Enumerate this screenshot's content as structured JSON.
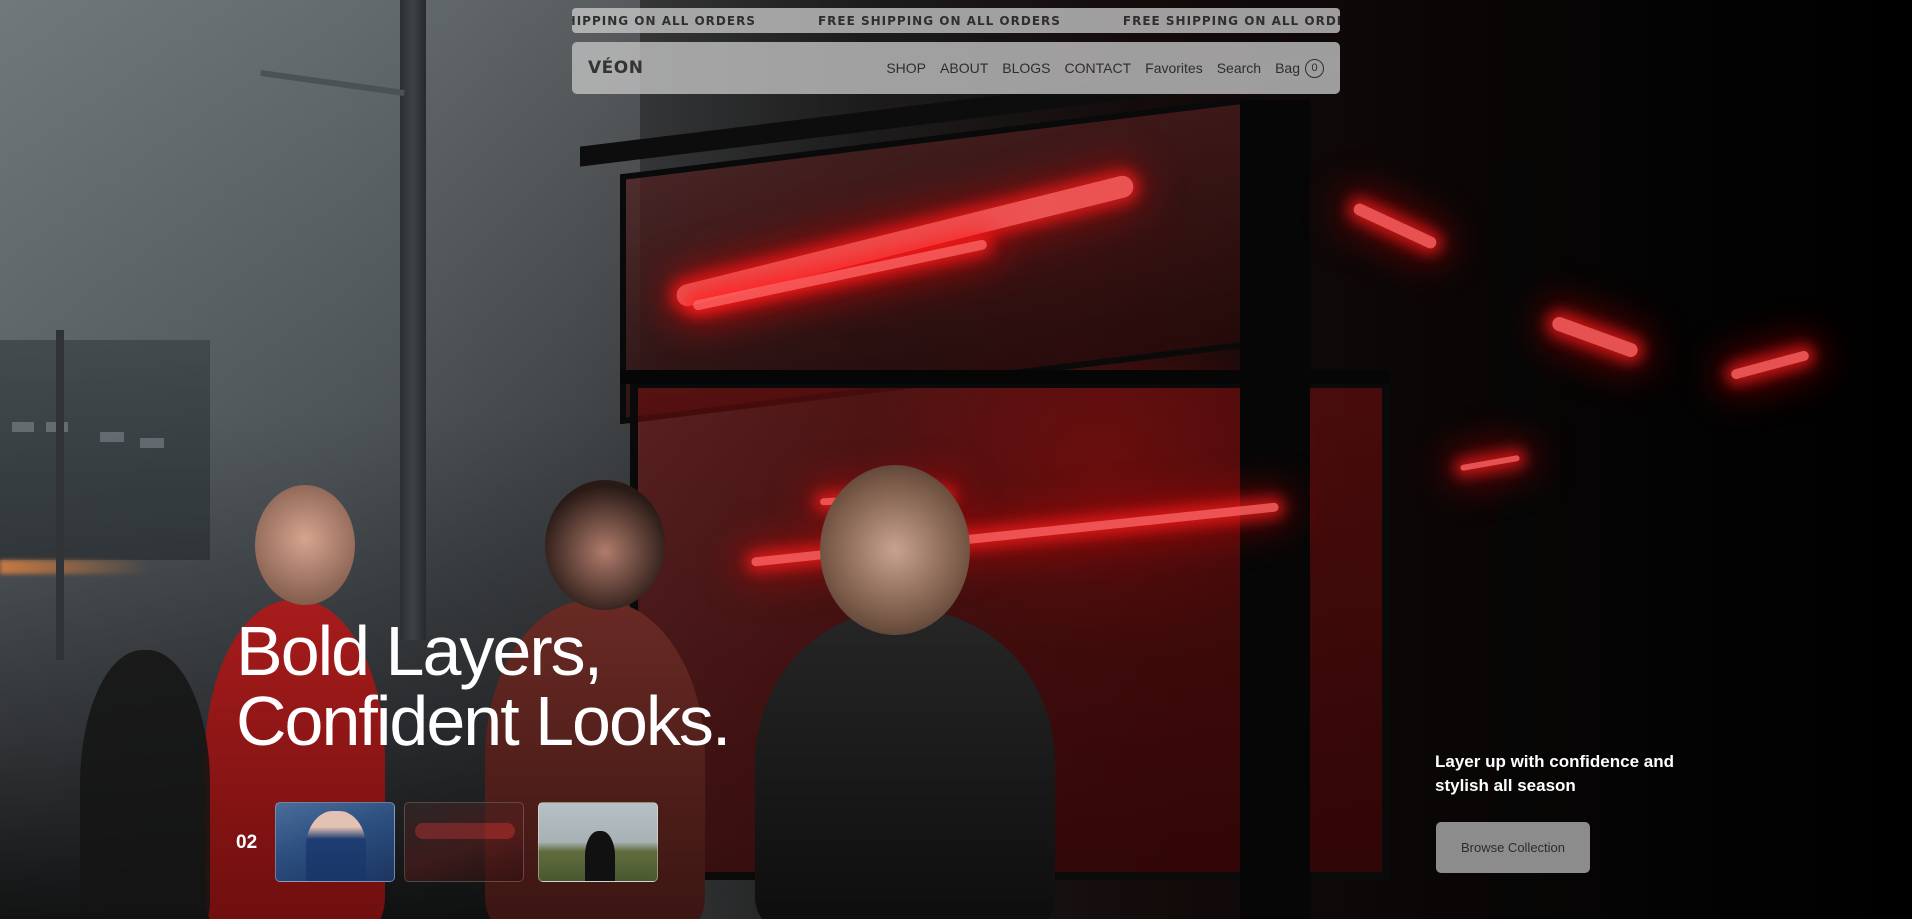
{
  "announcement": {
    "items": [
      "FREE SHIPPING ON ALL ORDERS",
      "FREE SHIPPING ON ALL ORDERS",
      "FREE SHIPPING ON ALL ORDERS"
    ]
  },
  "navbar": {
    "logo": "VÉON",
    "links": [
      "SHOP",
      "ABOUT",
      "BLOGS",
      "CONTACT",
      "Favorites",
      "Search"
    ],
    "bag_label": "Bag",
    "bag_count": "0"
  },
  "hero": {
    "headline_line1": "Bold Layers,",
    "headline_line2": "Confident Looks.",
    "tagline": "Layer up with confidence and stylish all season",
    "cta_label": "Browse Collection"
  },
  "slider": {
    "current": "02",
    "thumbnail_icons": [
      "person-covering-face-thumbnail",
      "neon-street-thumbnail",
      "figure-in-field-thumbnail"
    ]
  },
  "colors": {
    "neon_red": "#ff2a2a",
    "nav_bg": "#bebebe",
    "text_light": "#ffffff"
  }
}
